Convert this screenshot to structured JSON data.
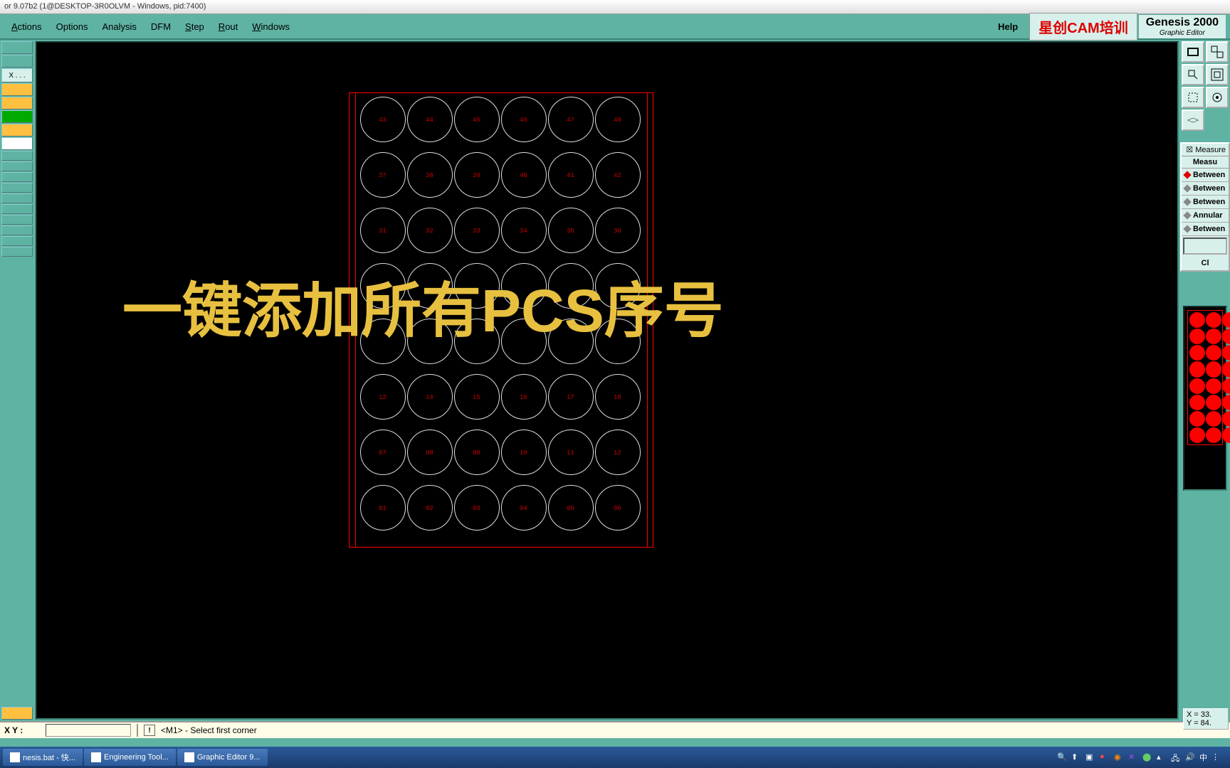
{
  "titlebar": "or 9.07b2 (1@DESKTOP-3R0OLVM - Windows, pid:7400)",
  "menu": {
    "actions": "Actions",
    "options": "Options",
    "analysis": "Analysis",
    "dfm": "DFM",
    "step": "Step",
    "rout": "Rout",
    "windows": "Windows",
    "help": "Help"
  },
  "logo": {
    "red": "星创CAM培训",
    "title": "Genesis 2000",
    "sub": "Graphic Editor"
  },
  "left": {
    "xdots": "X . . ."
  },
  "overlay": "一键添加所有PCS序号",
  "measure": {
    "title": "Measure",
    "header": "Measu",
    "r1": "Between",
    "r2": "Between",
    "r3": "Between",
    "r4": "Annular",
    "r5": "Between",
    "close": "Cl"
  },
  "coords": {
    "x": "X = 33.",
    "y": "Y = 84."
  },
  "status": {
    "xy": "X Y :",
    "msg": "<M1> - Select first corner"
  },
  "taskbar": {
    "t1": "nesis.bat - 快...",
    "t2": "Engineering Tool...",
    "t3": "Graphic Editor 9...",
    "tray_lang": "中"
  },
  "grid": {
    "rows": [
      [
        "43",
        "44",
        "45",
        "46",
        "47",
        "48"
      ],
      [
        "37",
        "38",
        "39",
        "40",
        "41",
        "42"
      ],
      [
        "31",
        "32",
        "33",
        "34",
        "35",
        "36"
      ],
      [
        "",
        "",
        "",
        "",
        "",
        ""
      ],
      [
        "",
        "",
        "",
        "",
        "",
        ""
      ],
      [
        "13",
        "14",
        "15",
        "16",
        "17",
        "18"
      ],
      [
        "07",
        "08",
        "09",
        "10",
        "11",
        "12"
      ],
      [
        "01",
        "02",
        "03",
        "04",
        "05",
        "06"
      ]
    ]
  }
}
